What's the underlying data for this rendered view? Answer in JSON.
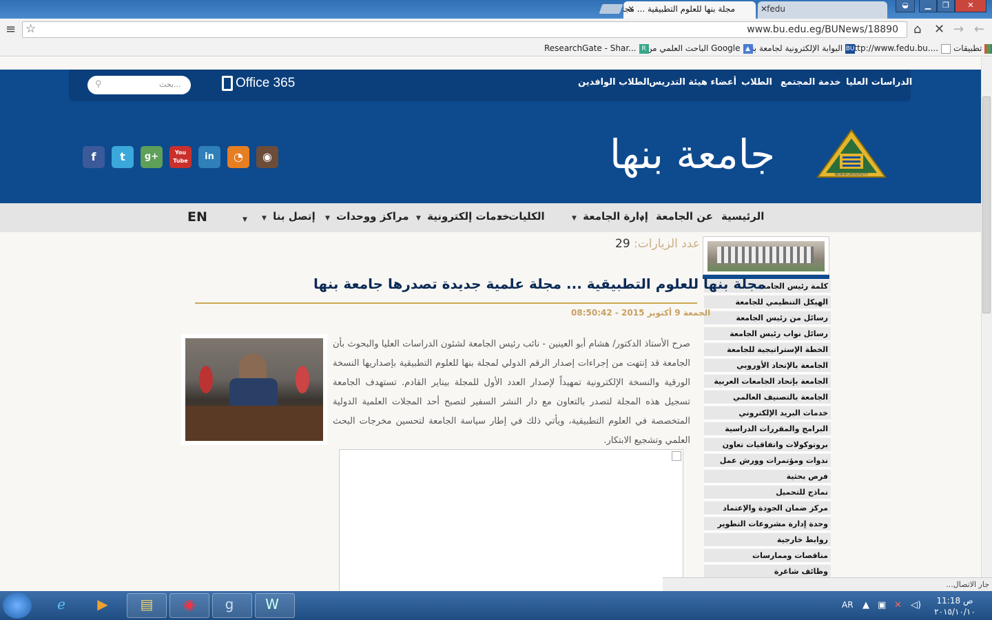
{
  "browser": {
    "tabs": [
      {
        "title": "مجلة بنها للعلوم التطبيقية ... مجلة"
      },
      {
        "title": "fedu"
      }
    ],
    "url": "www.bu.edu.eg/BUNews/18890",
    "bookmarks": [
      {
        "label": "تطبيقات"
      },
      {
        "label": "http://www.fedu.bu...."
      },
      {
        "label": "البوابة الإلكترونية لجامعة بنها"
      },
      {
        "label": "الباحث العلمي من Google"
      },
      {
        "label": "ResearchGate - Shar..."
      }
    ]
  },
  "header": {
    "top_nav": [
      "الدراسات العليا",
      "خدمة المجتمع",
      "الطلاب",
      "أعضاء هيئة التدريس",
      "الطلاب الوافدين"
    ],
    "search_placeholder": "بحث...",
    "office_label": "Office 365",
    "university_name": "جامعة بنها",
    "logo_text": "BENHA UNIVERSITY",
    "social": [
      "facebook-icon",
      "twitter-icon",
      "google-plus-icon",
      "youtube-icon",
      "linkedin-icon",
      "rss-icon",
      "instagram-icon"
    ]
  },
  "menu": {
    "items": [
      "الرئيسية",
      "عن الجامعة",
      "إدارة الجامعة",
      "الكليات",
      "خدمات إلكترونية",
      "مراكز ووحدات",
      "إتصل بنا"
    ],
    "lang": "EN"
  },
  "sidebar": {
    "items": [
      "كلمة رئيس الجامعة",
      "الهيكل التنظيمي للجامعة",
      "رسائل من رئيس الجامعة",
      "رسائل نواب رئيس الجامعة",
      "الخطة الإستراتيجية للجامعة",
      "الجامعة بالإتحاد الأوروبي",
      "الجامعة بإتحاد الجامعات العربية",
      "الجامعة بالتصنيف العالمي",
      "خدمات البريد الإلكتروني",
      "البرامج والمقررات الدراسية",
      "بروتوكولات واتفاقيات تعاون",
      "ندوات ومؤتمرات وورش عمل",
      "فرص بحثية",
      "نماذج للتحميل",
      "مركز ضمان الجودة والإعتماد",
      "وحدة إدارة مشروعات التطوير",
      "روابط خارجية",
      "مناقصات وممارسات",
      "وظائف شاغرة"
    ]
  },
  "article": {
    "visits_label": "عدد الزيارات:",
    "visits_count": "29",
    "title": "مجلة بنها للعلوم التطبيقية ... مجلة علمية جديدة تصدرها جامعة بنها",
    "date": "الجمعة 9 أكتوبر 2015 - 08:50:42",
    "body": "صرح الأستاذ الدكتور/ هشام أبو العينين - نائب رئيس الجامعة لشئون الدراسات العليا والبحوث بأن الجامعة قد إنتهت من إجراءات إصدار الرقم الدولي لمجلة بنها للعلوم التطبيقية بإصداريها النسخة الورقية والنسخة الإلكترونية تمهيداً لإصدار العدد الأول للمجلة بيناير القادم. تستهدف الجامعة تسجيل هذه المجلة لتصدر بالتعاون مع دار النشر السفير لتصبح أحد المجلات العلمية الدولية المتخصصة في العلوم التطبيقية، ويأتي ذلك في إطار سياسة الجامعة لتحسين مخرجات البحث العلمي وتشجيع الابتكار."
  },
  "status": "جار الاتصال...",
  "taskbar": {
    "lang": "AR",
    "time": "11:18 ص",
    "date": "٢٠١٥/١٠/١٠"
  }
}
